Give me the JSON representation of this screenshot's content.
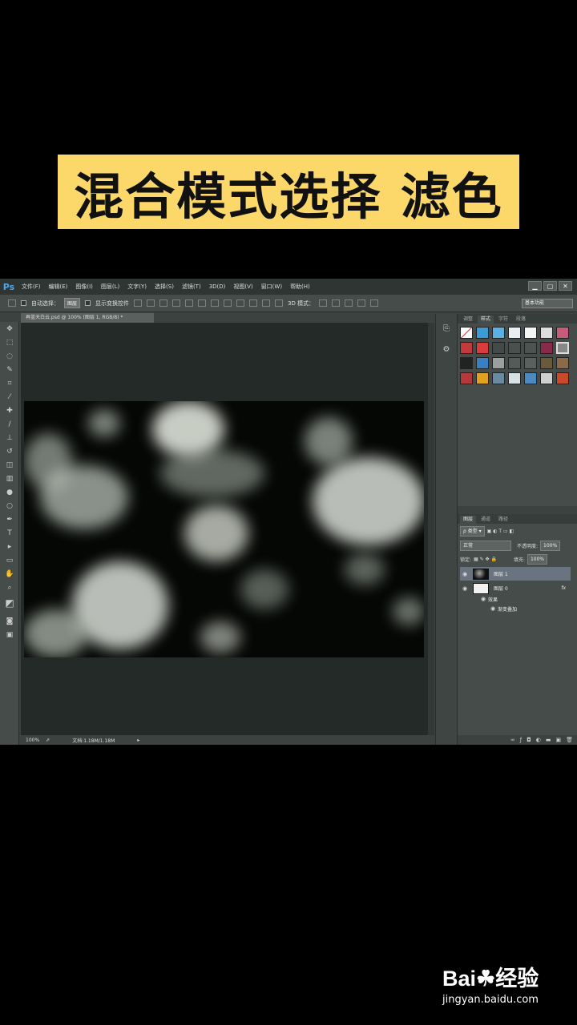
{
  "banner": {
    "text": "混合模式选择 滤色"
  },
  "app": {
    "logo": "Ps",
    "menu": [
      "文件(F)",
      "编辑(E)",
      "图像(I)",
      "图层(L)",
      "文字(Y)",
      "选择(S)",
      "滤镜(T)",
      "3D(D)",
      "视图(V)",
      "窗口(W)",
      "帮助(H)"
    ],
    "window_buttons": [
      "▁",
      "▢",
      "✕"
    ]
  },
  "options": {
    "auto_select_label": "自动选择：",
    "auto_select_value": "图层",
    "show_transform_label": "显示变换控件",
    "mode_3d_label": "3D 模式：",
    "workspace": "基本功能"
  },
  "document": {
    "tab_title": "再蓝天白云.psd @ 100% (图层 1, RGB/8) *",
    "zoom": "100%",
    "doc_info": "文档:1.18M/1.18M"
  },
  "styles_panel": {
    "tabs": [
      "调整",
      "样式",
      "字符",
      "段落"
    ],
    "active_tab": "样式"
  },
  "layers_panel": {
    "tabs": [
      "图层",
      "通道",
      "路径"
    ],
    "active_tab": "图层",
    "filter_label": "类型",
    "blend_mode": "正常",
    "opacity_label": "不透明度:",
    "opacity_value": "100%",
    "lock_label": "锁定:",
    "fill_label": "填充:",
    "fill_value": "100%",
    "layers": [
      {
        "name": "图层 1",
        "selected": true
      },
      {
        "name": "图层 0",
        "selected": false,
        "fx": "fx"
      }
    ],
    "effects_label": "效果",
    "effect_name": "渐变叠加"
  },
  "watermark": {
    "logo": "Bai☘经验",
    "url": "jingyan.baidu.com"
  }
}
